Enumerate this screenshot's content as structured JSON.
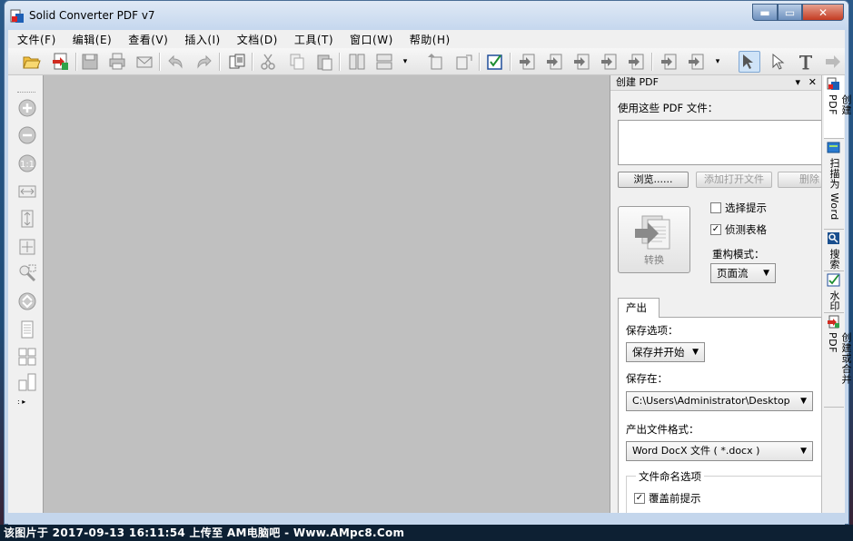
{
  "window": {
    "title": "Solid Converter PDF v7",
    "accent": "#c4d6ec",
    "close_color": "#c43b22"
  },
  "menu": [
    {
      "label": "文件(F)"
    },
    {
      "label": "编辑(E)"
    },
    {
      "label": "查看(V)"
    },
    {
      "label": "插入(I)"
    },
    {
      "label": "文档(D)"
    },
    {
      "label": "工具(T)"
    },
    {
      "label": "窗口(W)"
    },
    {
      "label": "帮助(H)"
    }
  ],
  "panel": {
    "header": "创建 PDF",
    "dropdown_glyph": "▾",
    "close_glyph": "✕",
    "use_files_label": "使用这些 PDF 文件：",
    "browse_label": "浏览......",
    "add_open_label": "添加打开文件",
    "delete_label": "删除",
    "select_prompt_label": "选择提示",
    "detect_tables_label": "侦测表格",
    "rebuild_mode_label": "重构模式：",
    "rebuild_mode_value": "页面流",
    "convert_label": "转换",
    "tab_output": "产出",
    "save_options_label": "保存选项：",
    "save_options_value": "保存并开始",
    "save_in_label": "保存在：",
    "save_in_value": "C:\\Users\\Administrator\\Desktop",
    "format_label": "产出文件格式：",
    "format_value": "Word DocX 文件 ( *.docx )",
    "naming_group_label": "文件命名选项",
    "overwrite_label": "覆盖前提示",
    "detect_tables_checked": true,
    "select_prompt_checked": false,
    "overwrite_checked": true
  },
  "side_tabs": [
    {
      "label": "创建 PDF",
      "icon": "pdf-create-icon"
    },
    {
      "label": "扫描为 Word",
      "icon": "scan-icon"
    },
    {
      "label": "搜索",
      "icon": "search-icon"
    },
    {
      "label": "水印",
      "icon": "watermark-icon"
    },
    {
      "label": "创建或合并 PDF",
      "icon": "merge-icon"
    }
  ],
  "watermark_text": "该图片于 2017-09-13 16:11:54 上传至 AM电脑吧 - Www.AMpc8.Com"
}
